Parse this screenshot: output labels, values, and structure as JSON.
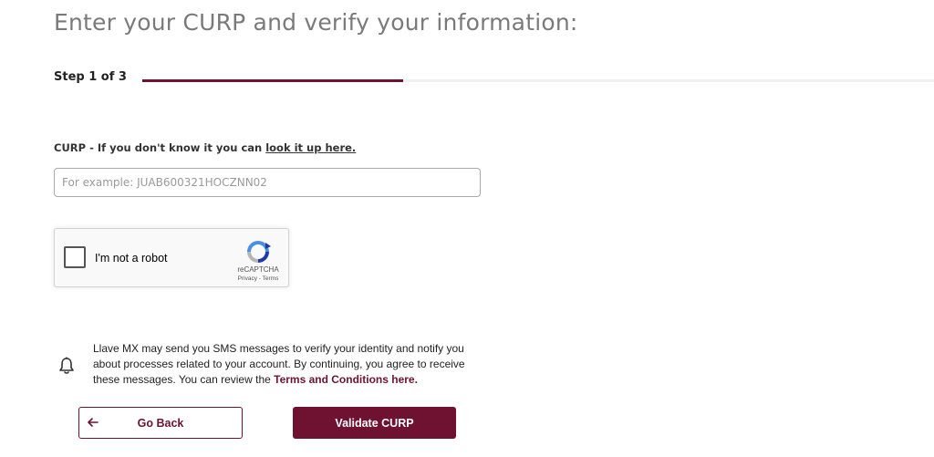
{
  "page": {
    "title": "Enter your CURP and verify your information:"
  },
  "steps": {
    "label": "Step 1 of 3",
    "progress_fraction": 0.33
  },
  "curp": {
    "label_prefix": "CURP - If you don't know it you can ",
    "lookup_link": "look it up here.",
    "placeholder": "For example: JUAB600321HOCZNN02",
    "value": ""
  },
  "recaptcha": {
    "checkbox_label": "I'm not a robot",
    "brand": "reCAPTCHA",
    "privacy": "Privacy",
    "separator": " - ",
    "terms": "Terms",
    "checked": false,
    "icon": "recaptcha-logo-icon"
  },
  "notice": {
    "icon": "bell-icon",
    "text": "Llave MX may send you SMS messages to verify your identity and notify you about processes related to your account. By continuing, you agree to receive these messages. You can review the ",
    "terms_link": "Terms and Conditions here."
  },
  "actions": {
    "back_label": "Go Back",
    "back_icon": "arrow-left-icon",
    "validate_label": "Validate CURP"
  },
  "colors": {
    "accent": "#6f1231",
    "title": "#7a7a7a",
    "track": "#f0f0f0"
  }
}
